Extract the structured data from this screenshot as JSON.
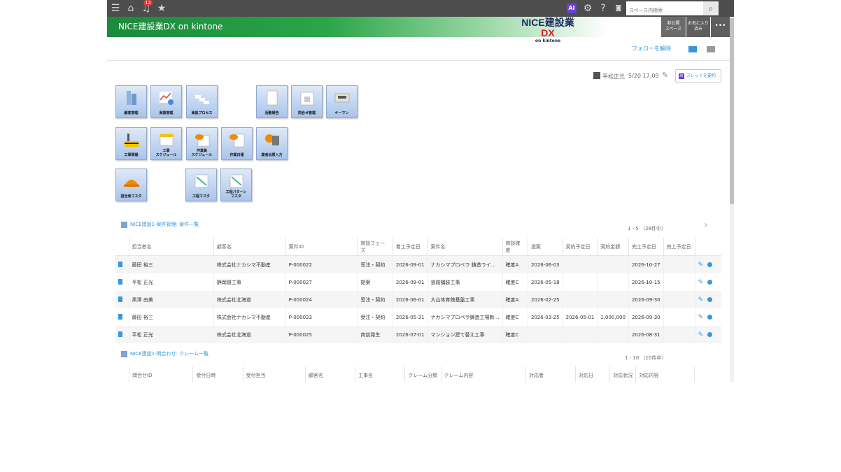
{
  "topbar": {
    "notification_count": "12",
    "ai_label": "AI",
    "search_placeholder": "スペース内検索"
  },
  "header": {
    "title": "NICE建設業DX on kintone",
    "logo_main": "NICE建設業",
    "logo_dx": "DX",
    "logo_sub": "on kintone",
    "btn_private_space": "非公開\nスペース",
    "btn_favorite": "お気に入り\n済み",
    "btn_more": "•••"
  },
  "thread": {
    "follow_label": "フォローを解除",
    "author": "平松正光",
    "datetime": "5/20 17:09",
    "summary_label": "スレッドを要約"
  },
  "tiles": [
    {
      "label": "顧客管理"
    },
    {
      "label": "商談管理"
    },
    {
      "label": "商談プロセス"
    },
    {
      "label": "活動報告"
    },
    {
      "label": "問合せ管理"
    },
    {
      "label": "キーマン"
    },
    {
      "label": "工事情報"
    },
    {
      "label": "工事\nスケジュール"
    },
    {
      "label": "作業員\nスケジュール"
    },
    {
      "label": "作業日報"
    },
    {
      "label": "業者伝票入力"
    },
    {
      "label": "担当者マスタ"
    },
    {
      "label": "工程マスタ"
    },
    {
      "label": "工程パターン\nマスタ"
    }
  ],
  "list1": {
    "title": "NICE建設1-案件管理: 案件一覧",
    "count": "1 - 5 （28件中）",
    "columns": [
      "担当者名",
      "顧客名",
      "案件ID",
      "商談フェーズ",
      "着工予定日",
      "案件名",
      "商談確度",
      "提案",
      "契約予定日",
      "契約金額",
      "完工予定日",
      "売上予定日"
    ],
    "rows": [
      [
        "藤田 裕三",
        "株式会社ナカシマ不動産",
        "P-000022",
        "受注・契約",
        "2026-09-01",
        "ナカシマプロペラ 鋳造ライ…",
        "確度A",
        "2026-06-03",
        "",
        "",
        "2026-10-27",
        ""
      ],
      [
        "平松 正光",
        "静岡冒工事",
        "P-000027",
        "提案",
        "2026-09-01",
        "道路舗装工事",
        "確度C",
        "2026-05-18",
        "",
        "",
        "2026-10-15",
        ""
      ],
      [
        "黒澤 由美",
        "株式会社北海道",
        "P-000024",
        "受注・契約",
        "2026-06-01",
        "大山体育館基盤工事",
        "確度A",
        "2026-02-25",
        "",
        "",
        "2026-09-30",
        ""
      ],
      [
        "藤田 裕三",
        "株式会社ナカシマ不動産",
        "P-000023",
        "受注・契約",
        "2026-05-31",
        "ナカシマプロペラ鋳造工場新…",
        "確度C",
        "2026-03-25",
        "2026-05-01",
        "1,000,000",
        "2026-09-30",
        ""
      ],
      [
        "平松 正光",
        "株式会社北海道",
        "P-000025",
        "商談発生",
        "2026-07-01",
        "マンション建て替え工事",
        "確度C",
        "",
        "",
        "",
        "2026-08-31",
        ""
      ]
    ]
  },
  "list2": {
    "title": "NICE建設1-問合わせ: クレーム一覧",
    "count": "1 - 10 （10件中）",
    "columns": [
      "問合せID",
      "受付日時",
      "受付担当",
      "顧客名",
      "工事名",
      "クレーム分類",
      "クレーム内容",
      "対応者",
      "対応日",
      "対応状況",
      "対応内容"
    ]
  },
  "colors": {
    "topbar": "#4d4d4d",
    "header_green": "#1a8a3c",
    "accent_blue": "#3498db",
    "ai_purple": "#6c3fd8"
  }
}
